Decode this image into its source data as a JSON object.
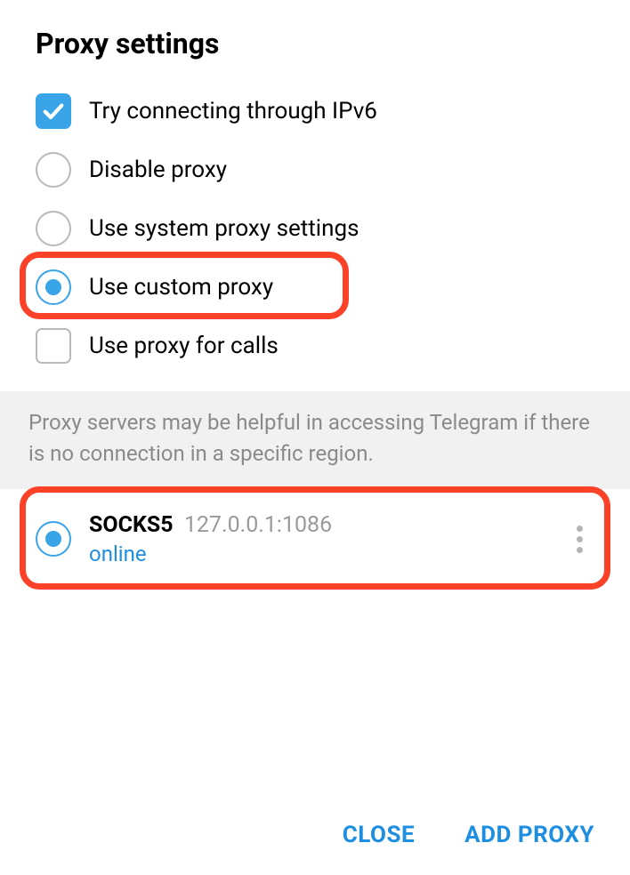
{
  "title": "Proxy settings",
  "options": {
    "ipv6": {
      "label": "Try connecting through IPv6",
      "checked": true,
      "kind": "checkbox"
    },
    "disable": {
      "label": "Disable proxy",
      "checked": false,
      "kind": "radio"
    },
    "system": {
      "label": "Use system proxy settings",
      "checked": false,
      "kind": "radio"
    },
    "custom": {
      "label": "Use custom proxy",
      "checked": true,
      "kind": "radio"
    },
    "calls": {
      "label": "Use proxy for calls",
      "checked": false,
      "kind": "checkbox"
    }
  },
  "info_text": "Proxy servers may be helpful in accessing Telegram if there is no connection in a specific region.",
  "proxy_entry": {
    "type": "SOCKS5",
    "address": "127.0.0.1:1086",
    "status": "online",
    "selected": true
  },
  "footer": {
    "close": "CLOSE",
    "add": "ADD PROXY"
  },
  "highlights": [
    "use-custom-proxy",
    "proxy-entry"
  ]
}
